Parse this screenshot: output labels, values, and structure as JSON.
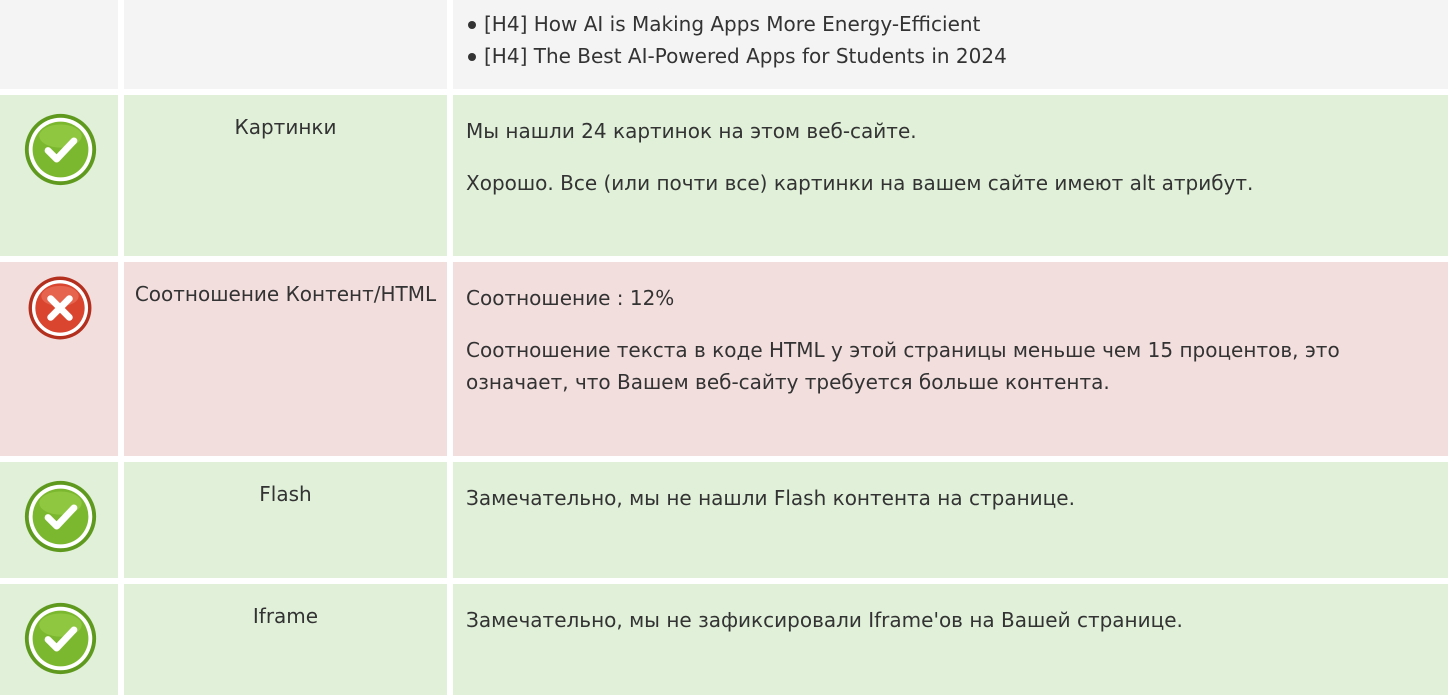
{
  "colors": {
    "neutral_bg": "#f4f4f4",
    "success_bg": "#e0f0d9",
    "error_bg": "#f3dede",
    "success_icon": "#7cb82f",
    "error_icon": "#d9452f"
  },
  "headings_row": {
    "items": [
      "[H4] How AI is Making Apps More Energy-Efficient",
      "[H4] The Best AI-Powered Apps for Students in 2024"
    ]
  },
  "rows": [
    {
      "status_icon": "check-circle-icon",
      "label": "Картинки",
      "p1": "Мы нашли 24 картинок на этом веб-сайте.",
      "p2": "Хорошо. Все (или почти все) картинки на вашем сайте имеют alt атрибут."
    },
    {
      "status_icon": "error-x-circle-icon",
      "label": "Соотношение Контент/HTML",
      "p1": "Соотношение : 12%",
      "p2": "Соотношение текста в коде HTML у этой страницы меньше чем 15 процентов, это означает, что Вашем веб-сайту требуется больше контента."
    },
    {
      "status_icon": "check-circle-icon",
      "label": "Flash",
      "p1": "Замечательно, мы не нашли Flash контента на странице."
    },
    {
      "status_icon": "check-circle-icon",
      "label": "Iframe",
      "p1": "Замечательно, мы не зафиксировали Iframe'ов на Вашей странице."
    }
  ]
}
